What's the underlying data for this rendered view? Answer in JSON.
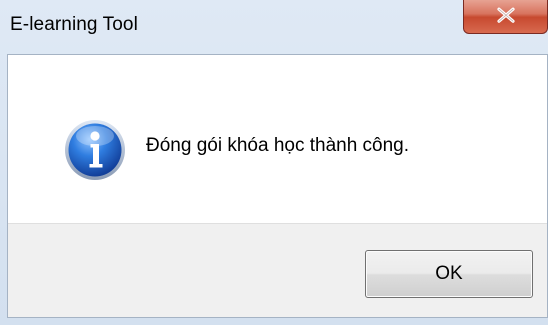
{
  "window": {
    "title": "E-learning Tool",
    "close_icon": "close-icon",
    "close_color": "#c7492f"
  },
  "dialog": {
    "icon": "information-icon",
    "icon_color": "#1f5fbf",
    "message": "Đóng gói khóa học thành công.",
    "ok_label": "OK"
  }
}
